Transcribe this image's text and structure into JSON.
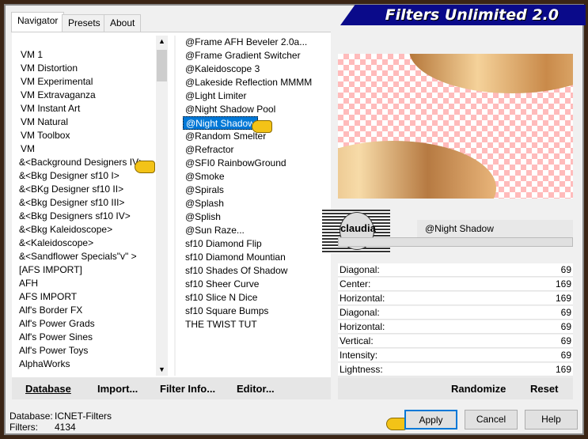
{
  "title": "Filters Unlimited 2.0",
  "tabs": [
    "Navigator",
    "Presets",
    "About"
  ],
  "categories": [
    "VM 1",
    "VM Distortion",
    "VM Experimental",
    "VM Extravaganza",
    "VM Instant Art",
    "VM Natural",
    "VM Toolbox",
    "VM",
    "&<Background Designers IV>",
    "&<Bkg Designer sf10 I>",
    "&<BKg Designer sf10 II>",
    "&<Bkg Designer sf10 III>",
    "&<Bkg Designers sf10 IV>",
    "&<Bkg Kaleidoscope>",
    "&<Kaleidoscope>",
    "&<Sandflower Specials\"v\" >",
    "[AFS IMPORT]",
    "AFH",
    "AFS IMPORT",
    "Alf's Border FX",
    "Alf's Power Grads",
    "Alf's Power Sines",
    "Alf's Power Toys",
    "AlphaWorks"
  ],
  "selected_category_index": 8,
  "filters": [
    "@Frame AFH Beveler 2.0a...",
    "@Frame Gradient Switcher",
    "@Kaleidoscope 3",
    "@Lakeside Reflection MMMM",
    "@Light Limiter",
    "@Night Shadow Pool",
    "@Night Shadow",
    "@Random Smelter",
    "@Refractor",
    "@SFI0 RainbowGround",
    "@Smoke",
    "@Spirals",
    "@Splash",
    "@Splish",
    "@Sun Raze...",
    "sf10 Diamond Flip",
    "sf10 Diamond Mountian",
    "sf10 Shades Of Shadow",
    "sf10 Sheer Curve",
    "sf10 Slice N Dice",
    "sf10 Square Bumps",
    "THE TWIST TUT"
  ],
  "selected_filter_index": 6,
  "filter_name": "@Night Shadow",
  "logo_text": "claudia",
  "params": [
    {
      "label": "Diagonal:",
      "value": "69"
    },
    {
      "label": "Center:",
      "value": "169"
    },
    {
      "label": "Horizontal:",
      "value": "169"
    },
    {
      "label": "Diagonal:",
      "value": "69"
    },
    {
      "label": "Horizontal:",
      "value": "69"
    },
    {
      "label": "Vertical:",
      "value": "69"
    },
    {
      "label": "Intensity:",
      "value": "69"
    },
    {
      "label": "Lightness:",
      "value": "169"
    }
  ],
  "buttons": {
    "database": "Database",
    "import": "Import...",
    "filter_info": "Filter Info...",
    "editor": "Editor...",
    "randomize": "Randomize",
    "reset": "Reset",
    "apply": "Apply",
    "cancel": "Cancel",
    "help": "Help"
  },
  "status": {
    "database_label": "Database:",
    "database_value": "ICNET-Filters",
    "filters_label": "Filters:",
    "filters_value": "4134"
  },
  "colors": {
    "frame": "#3b2515",
    "banner": "#0a0a8a",
    "selection": "#0078d7"
  }
}
